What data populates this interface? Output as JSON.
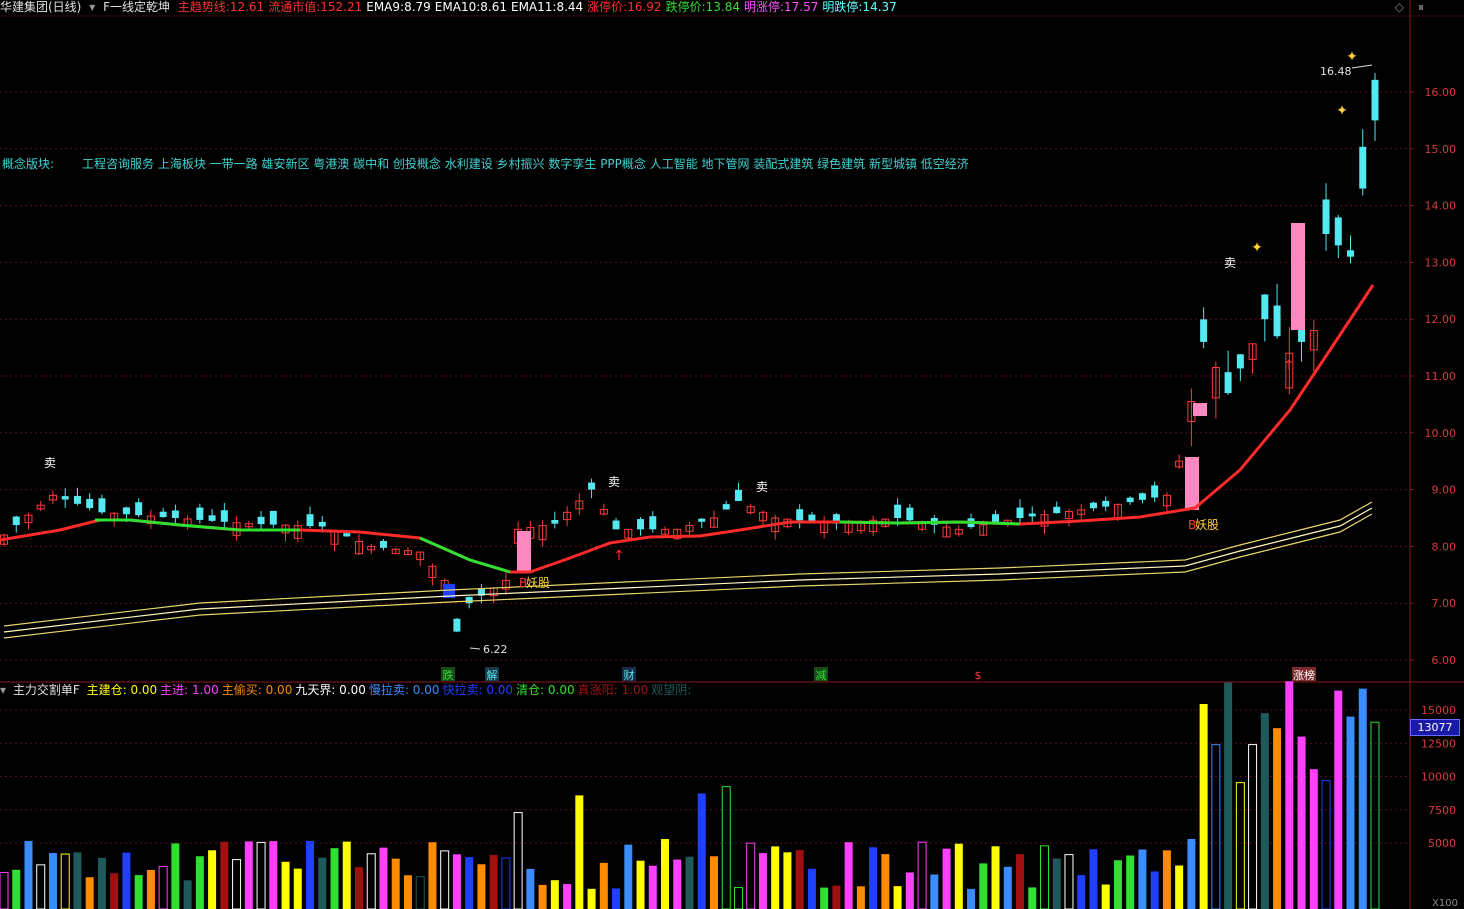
{
  "header": {
    "stock_name": "华建集团(日线)",
    "formula_name": "F一线定乾坤",
    "items": [
      {
        "label": "主趋势线:",
        "value": "12.61",
        "color": "#ff3030"
      },
      {
        "label": "流通市值:",
        "value": "152.21",
        "color": "#ff3030"
      },
      {
        "label": "EMA9:",
        "value": "8.79",
        "color": "#ffffff"
      },
      {
        "label": "EMA10:",
        "value": "8.61",
        "color": "#ffffff"
      },
      {
        "label": "EMA11:",
        "value": "8.44",
        "color": "#ffffff"
      },
      {
        "label": "涨停价:",
        "value": "16.92",
        "color": "#ff3030"
      },
      {
        "label": "跌停价:",
        "value": "13.84",
        "color": "#30e030"
      },
      {
        "label": "明涨停:",
        "value": "17.57",
        "color": "#ff50ff"
      },
      {
        "label": "明跌停:",
        "value": "14.37",
        "color": "#60ffff"
      }
    ]
  },
  "concepts": {
    "label": "概念版块:",
    "text": "工程咨询服务 上海板块 一带一路 雄安新区 粤港澳 碳中和 创投概念 水利建设 乡村振兴 数字孪生 PPP概念 人工智能 地下管网 装配式建筑 绿色建筑 新型城镇 低空经济"
  },
  "price_axis": [
    "16.00",
    "15.00",
    "14.00",
    "13.00",
    "12.00",
    "11.00",
    "10.00",
    "9.00",
    "8.00",
    "7.00",
    "6.00"
  ],
  "annotations": {
    "high_label": "16.48",
    "low_label": "6.22",
    "sell_marker": "卖",
    "demon_stock": "妖股",
    "b_marker": "B"
  },
  "bottom_markers": [
    "跌",
    "解",
    "财",
    "减",
    "$",
    "涨榜"
  ],
  "sub_header": {
    "title": "主力交割单F",
    "items": [
      {
        "label": "主建仓:",
        "value": "0.00",
        "color": "#ffff00"
      },
      {
        "label": "主进:",
        "value": "1.00",
        "color": "#ff40ff"
      },
      {
        "label": "主偷买:",
        "value": "0.00",
        "color": "#ff8c00"
      },
      {
        "label": "九天界:",
        "value": "0.00",
        "color": "#ffffff"
      },
      {
        "label": "慢拉卖:",
        "value": "0.00",
        "color": "#3a8cff"
      },
      {
        "label": "快拉卖:",
        "value": "0.00",
        "color": "#2040ff"
      },
      {
        "label": "清仓:",
        "value": "0.00",
        "color": "#30e030"
      },
      {
        "label": "真涨阳:",
        "value": "1.00",
        "color": "#a01010"
      },
      {
        "label": "观望阴:",
        "value": "",
        "color": "#1e5a5a"
      }
    ]
  },
  "vol_axis": [
    "15000",
    "12500",
    "10000",
    "7500",
    "5000"
  ],
  "current_value": "13077",
  "unit": "X100",
  "controls": {
    "diamond": "◇",
    "arrows": "⏸"
  }
}
